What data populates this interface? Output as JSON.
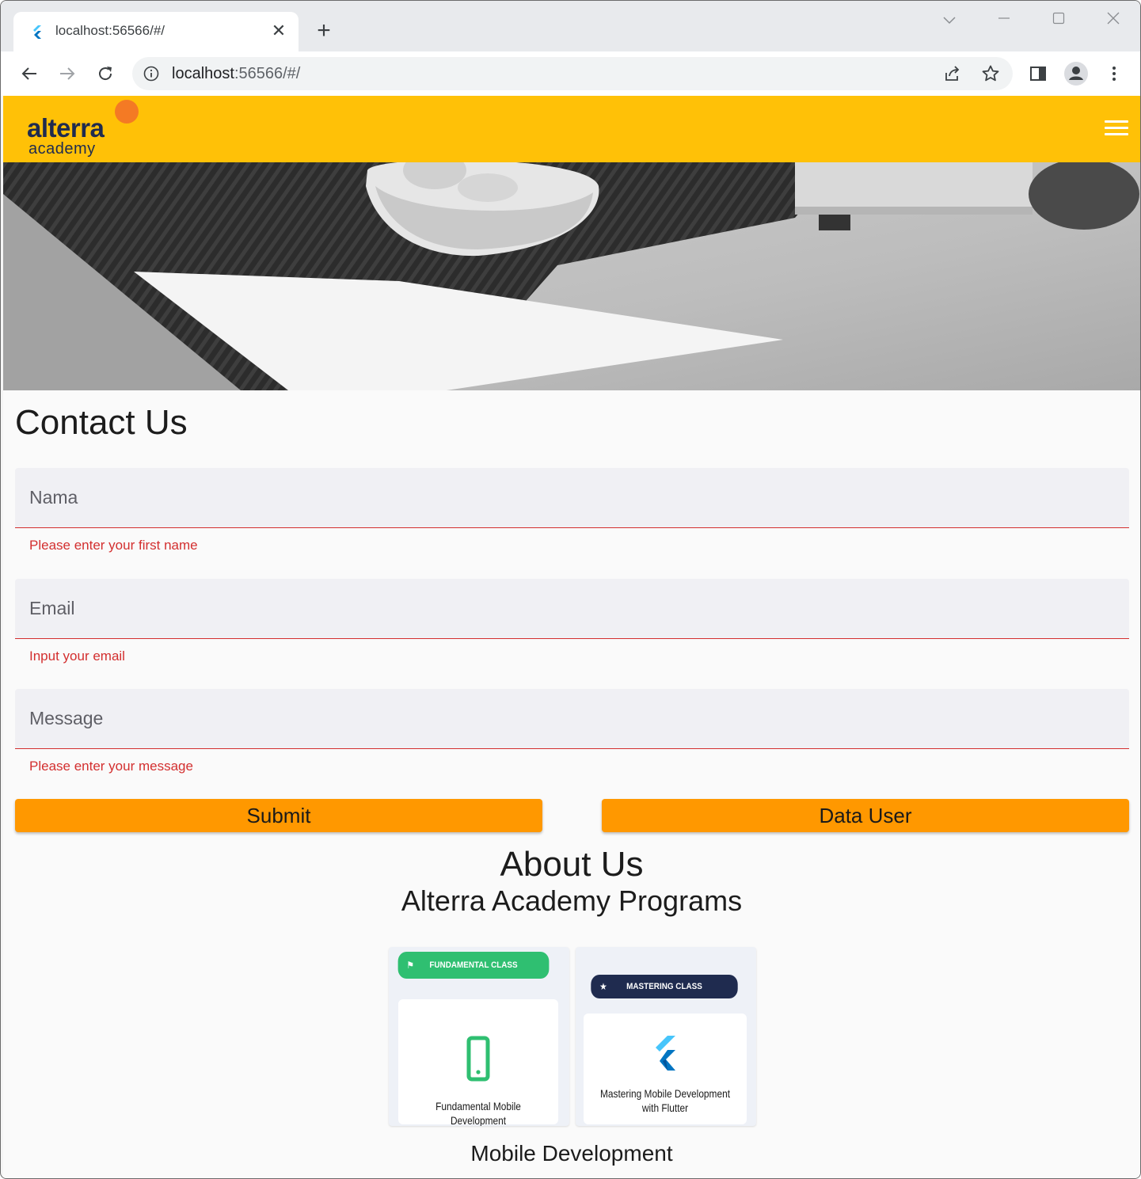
{
  "browser": {
    "tab_title": "localhost:56566/#/",
    "url_host": "localhost",
    "url_rest": ":56566/#/"
  },
  "appbar": {
    "logo_main": "alterra",
    "logo_sub": "academy",
    "brand_color": "#ffc107",
    "logo_dot_color": "#f47a24"
  },
  "contact": {
    "heading": "Contact Us",
    "fields": [
      {
        "placeholder": "Nama",
        "value": "",
        "error": "Please enter your first name"
      },
      {
        "placeholder": "Email",
        "value": "",
        "error": "Input your email"
      },
      {
        "placeholder": "Message",
        "value": "",
        "error": "Please enter your message"
      }
    ],
    "submit_label": "Submit",
    "data_user_label": "Data User",
    "button_color": "#ff9800",
    "error_color": "#d32f2f"
  },
  "about": {
    "heading": "About Us",
    "subheading": "Alterra Academy Programs",
    "cards": [
      {
        "badge": "FUNDAMENTAL CLASS",
        "badge_color": "#2fbf71",
        "icon": "phone-icon",
        "title": "Fundamental Mobile Development"
      },
      {
        "badge": "MASTERING CLASS",
        "badge_color": "#1f2b4f",
        "icon": "flutter-icon",
        "title": "Mastering Mobile Development with Flutter"
      }
    ],
    "section_label": "Mobile Development"
  }
}
